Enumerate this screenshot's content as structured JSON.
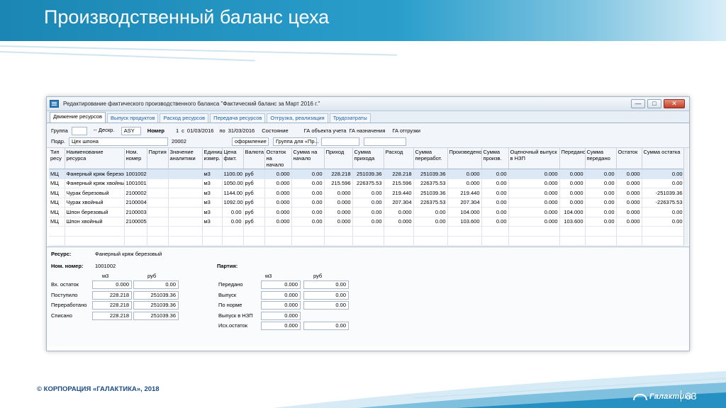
{
  "slide": {
    "title": "Производственный баланс цеха",
    "copyright": "© КОРПОРАЦИЯ «ГАЛАКТИКА», 2018",
    "logo_text": "Галактика",
    "page_number": "33"
  },
  "window": {
    "title": "Редактирование фактического производственного баланса \"Фактический баланс за Март 2016 г.\"",
    "controls": {
      "minimize": "—",
      "maximize": "□",
      "close": "✕"
    }
  },
  "tabs": [
    "Движение ресурсов",
    "Выпуск продуктов",
    "Расход ресурсов",
    "Передача ресурсов",
    "Отгрузка, реализация",
    "Трудозатраты"
  ],
  "filters": {
    "group_label": "Группа",
    "group_value": "",
    "descr_value": "-- Дескр.",
    "asy_value": "ASY",
    "number_label": "Номер",
    "number_value": "1",
    "from_label": "с",
    "from_value": "01/03/2016",
    "to_label": "по",
    "to_value": "31/03/2016",
    "state_label": "Состояние",
    "ga_obj_label": "ГА объекта учета",
    "ga_purpose_label": "ГА назначения",
    "ga_ship_label": "ГА отгрузки",
    "podr_label": "Подр.",
    "podr_value": "Цех шпона",
    "podr_code": "20002",
    "state_value": "оформление",
    "group_for_value": "Группа для «Пр..."
  },
  "grid": {
    "headers": [
      "Тип ресу",
      "Наименование ресурса",
      "Ном. номер",
      "Партия",
      "Значение аналитики",
      "Единица измер.",
      "Цена факт.",
      "Валюта",
      "Остаток на начало",
      "Сумма на начало",
      "Приход",
      "Сумма прихода",
      "Расход",
      "Сумма переработ.",
      "Произведено",
      "Сумма произв.",
      "Оценочный выпуск в НЗП",
      "Передано",
      "Сумма передано",
      "Остаток",
      "Сумма остатка"
    ],
    "rows": [
      [
        "МЦ",
        "Фанерный кряж березовый",
        "1001002",
        "",
        "",
        "м3",
        "1100.00",
        "руб",
        "0.000",
        "0.00",
        "228.218",
        "251039.36",
        "228.218",
        "251039.36",
        "0.000",
        "0.00",
        "0.000",
        "0.000",
        "0.00",
        "0.000",
        "0.00"
      ],
      [
        "МЦ",
        "Фанерный кряж хвойный",
        "1001001",
        "",
        "",
        "м3",
        "1050.00",
        "руб",
        "0.000",
        "0.00",
        "215.596",
        "226375.53",
        "215.596",
        "226375.53",
        "0.000",
        "0.00",
        "0.000",
        "0.000",
        "0.00",
        "0.000",
        "0.00"
      ],
      [
        "МЦ",
        "Чурак березовый",
        "2100002",
        "",
        "",
        "м3",
        "1144.00",
        "руб",
        "0.000",
        "0.00",
        "0.000",
        "0.00",
        "219.440",
        "251039.36",
        "219.440",
        "0.00",
        "0.000",
        "0.000",
        "0.00",
        "0.000",
        "-251039.36"
      ],
      [
        "МЦ",
        "Чурак хвойный",
        "2100004",
        "",
        "",
        "м3",
        "1092.00",
        "руб",
        "0.000",
        "0.00",
        "0.000",
        "0.00",
        "207.304",
        "226375.53",
        "207.304",
        "0.00",
        "0.000",
        "0.000",
        "0.00",
        "0.000",
        "-226375.53"
      ],
      [
        "МЦ",
        "Шпон березовый",
        "2100003",
        "",
        "",
        "м3",
        "0.00",
        "руб",
        "0.000",
        "0.00",
        "0.000",
        "0.00",
        "0.000",
        "0.00",
        "104.000",
        "0.00",
        "0.000",
        "104.000",
        "0.00",
        "0.000",
        "0.00"
      ],
      [
        "МЦ",
        "Шпон хвойный",
        "2100005",
        "",
        "",
        "м3",
        "0.00",
        "руб",
        "0.000",
        "0.00",
        "0.000",
        "0.00",
        "0.000",
        "0.00",
        "103.600",
        "0.00",
        "0.000",
        "103.600",
        "0.00",
        "0.000",
        "0.00"
      ]
    ]
  },
  "detail": {
    "resource_label": "Ресурс:",
    "resource_value": "Фанерный кряж березовый",
    "nom_label": "Ном. номер:",
    "nom_value": "1001002",
    "party_label": "Партия:",
    "unit_m3": "м3",
    "unit_rub": "руб",
    "left": [
      {
        "label": "Вх. остаток",
        "m3": "0.000",
        "rub": "0.00"
      },
      {
        "label": "Поступило",
        "m3": "228.218",
        "rub": "251039.36"
      },
      {
        "label": "Переработано",
        "m3": "228.218",
        "rub": "251039.36"
      },
      {
        "label": "Списано",
        "m3": "228.218",
        "rub": "251039.36"
      }
    ],
    "right": [
      {
        "label": "Передано",
        "m3": "0.000",
        "rub": "0.00"
      },
      {
        "label": "Выпуск",
        "m3": "0.000",
        "rub": "0.00"
      },
      {
        "label": "По норме",
        "m3": "0.000",
        "rub": "0.00"
      },
      {
        "label": "Выпуск в НЗП",
        "m3": "0.000",
        "rub": ""
      },
      {
        "label": "Исх.остаток",
        "m3": "0.000",
        "rub": "0.00"
      }
    ]
  }
}
